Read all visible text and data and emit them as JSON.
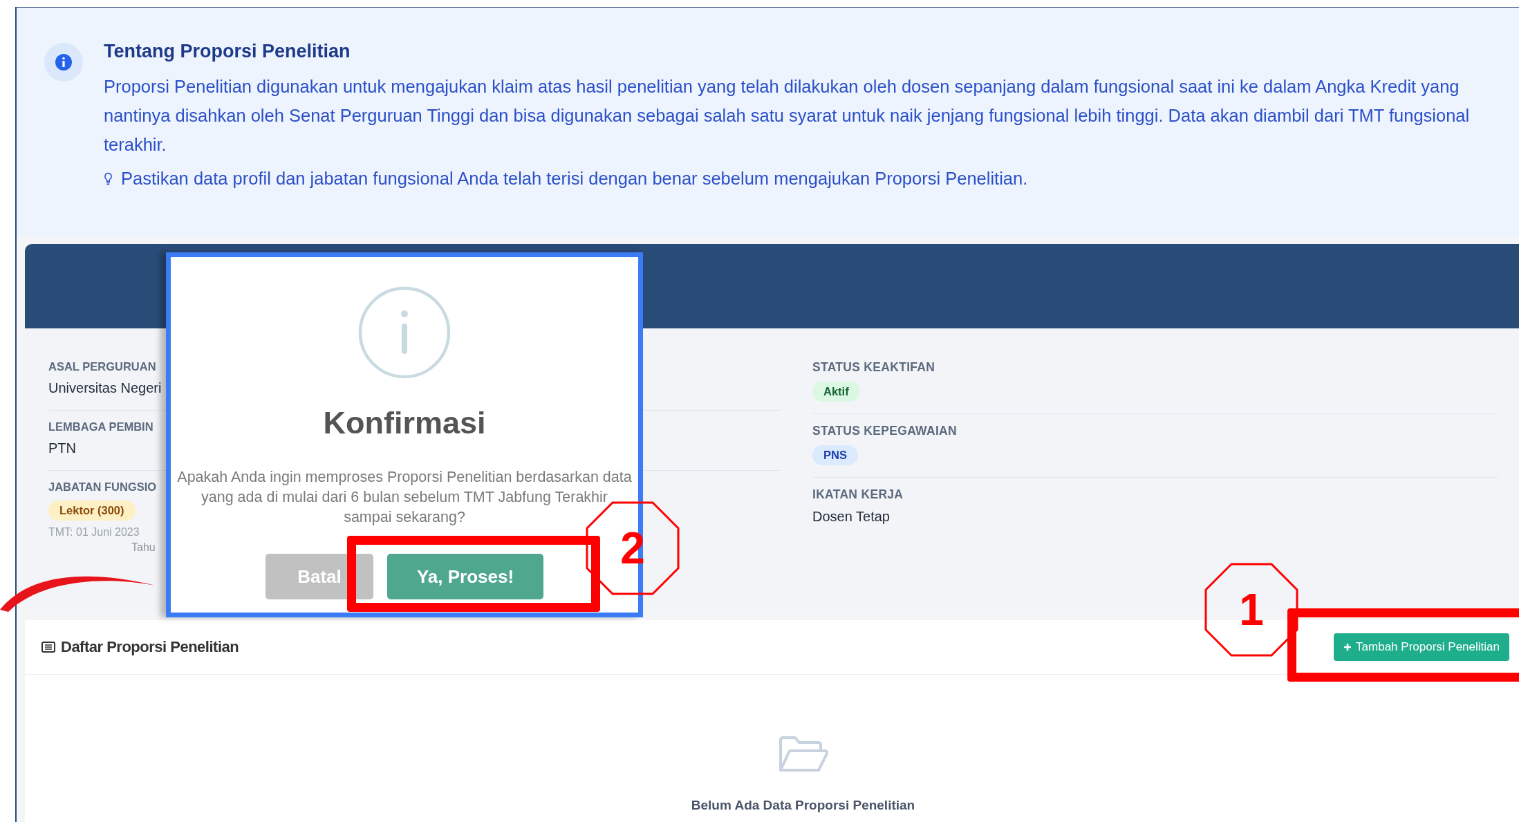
{
  "info": {
    "title": "Tentang Proporsi Penelitian",
    "paragraph": "Proporsi Penelitian digunakan untuk mengajukan klaim atas hasil penelitian yang telah dilakukan oleh dosen sepanjang dalam fungsional saat ini ke dalam Angka Kredit yang nantinya disahkan oleh Senat Perguruan Tinggi dan bisa digunakan sebagai salah satu syarat untuk naik jenjang fungsional lebih tinggi. Data akan diambil dari TMT fungsional terakhir.",
    "tip": "Pastikan data profil dan jabatan fungsional Anda telah terisi dengan benar sebelum mengajukan Proporsi Penelitian."
  },
  "profile": {
    "left": [
      {
        "label": "ASAL PERGURUAN",
        "kind": "text",
        "value": "Universitas Negeri"
      },
      {
        "label": "LEMBAGA PEMBIN",
        "kind": "text",
        "value": "PTN"
      },
      {
        "label": "JABATAN FUNGSIO",
        "kind": "badge",
        "value": "Lektor (300)",
        "color": "#8a4a0b",
        "notes": [
          "TMT: 01 Juni 2023",
          "Tahu"
        ]
      }
    ],
    "right": [
      {
        "label": "STATUS KEAKTIFAN",
        "kind": "badge",
        "value": "Aktif",
        "color": "#166534"
      },
      {
        "label": "STATUS KEPEGAWAIAN",
        "kind": "badge",
        "value": "PNS",
        "color": "#1e40af"
      },
      {
        "label": "IKATAN KERJA",
        "kind": "text",
        "value": "Dosen Tetap"
      }
    ]
  },
  "list": {
    "title": "Daftar Proporsi Penelitian",
    "add_button": "Tambah Proporsi Penelitian",
    "empty_text": "Belum Ada Data Proporsi Penelitian"
  },
  "modal": {
    "title": "Konfirmasi",
    "message": "Apakah Anda ingin memproses Proporsi Penelitian berdasarkan data yang ada di mulai dari 6 bulan sebelum TMT Jabfung Terakhir sampai sekarang?",
    "buttons": [
      {
        "label": "Batal",
        "kind": "cancel"
      },
      {
        "label": "Ya, Proses!",
        "kind": "confirm"
      }
    ]
  },
  "annotations": [
    {
      "number": "1"
    },
    {
      "number": "2"
    }
  ]
}
